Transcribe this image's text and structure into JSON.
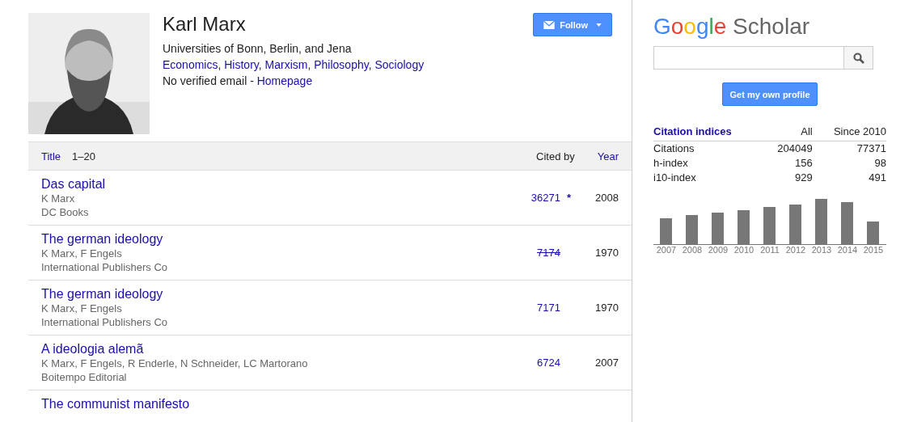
{
  "profile": {
    "name": "Karl Marx",
    "affiliation": "Universities of Bonn, Berlin, and Jena",
    "interests": [
      {
        "label": "Economics",
        "separator": ","
      },
      {
        "label": "History",
        "separator": ","
      },
      {
        "label": "Marxism",
        "separator": ","
      },
      {
        "label": "Philosophy",
        "separator": ","
      },
      {
        "label": "Sociology"
      }
    ],
    "email_note": "No verified email - ",
    "homepage": "Homepage"
  },
  "follow_button": {
    "label": "Follow"
  },
  "table": {
    "title_header": "Title",
    "range": "1–20",
    "cited_header": "Cited by",
    "year_header": "Year",
    "rows": [
      {
        "title": "Das capital",
        "authors": "K Marx",
        "source": "DC Books",
        "cited": "36271",
        "struck": false,
        "mark": "*",
        "year": "2008"
      },
      {
        "title": "The german ideology",
        "authors": "K Marx, F Engels",
        "source": "International Publishers Co",
        "cited": "7174",
        "struck": true,
        "year": "1970"
      },
      {
        "title": "The german ideology",
        "authors": "K Marx, F Engels",
        "source": "International Publishers Co",
        "cited": "7171",
        "struck": false,
        "year": "1970"
      },
      {
        "title": "A ideologia alemã",
        "authors": "K Marx, F Engels, R Enderle, N Schneider, LC Martorano",
        "source": "Boitempo Editorial",
        "cited": "6724",
        "struck": false,
        "year": "2007"
      },
      {
        "title": "The communist manifesto"
      }
    ]
  },
  "sidebar": {
    "logo_brand": "Google",
    "logo_product": "Scholar",
    "own_profile_button": "Get my own profile",
    "indices": {
      "heading": "Citation indices",
      "columns": [
        "All",
        "Since 2010"
      ],
      "rows": [
        {
          "label": "Citations",
          "all": "204049",
          "since": "77371"
        },
        {
          "label": "h-index",
          "all": "156",
          "since": "98"
        },
        {
          "label": "i10-index",
          "all": "929",
          "since": "491"
        }
      ]
    },
    "citations_chart": {
      "years": [
        "2007",
        "2008",
        "2009",
        "2010",
        "2011",
        "2012",
        "2013",
        "2014",
        "2015"
      ]
    }
  }
}
